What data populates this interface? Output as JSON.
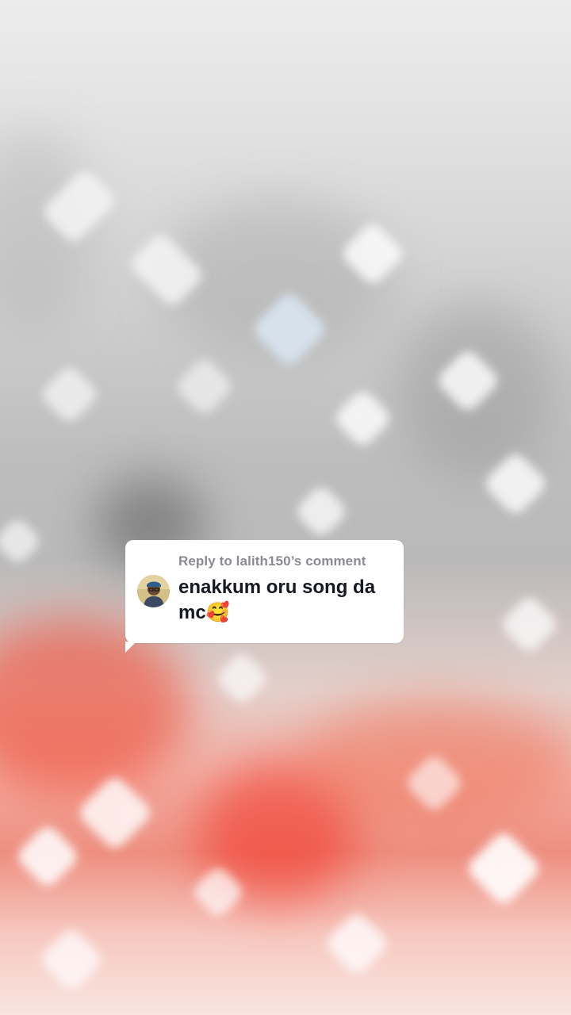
{
  "video": {
    "description_layer": "blurred-video-background"
  },
  "reply_sticker": {
    "reply_label": "Reply to lalith150’s comment",
    "comment_text": "enakkum oru song da mc🥰",
    "avatar_icon": "user-avatar-icon"
  },
  "colors": {
    "card_background": "#ffffff",
    "reply_label": "#8a8b91",
    "comment_text": "#161823",
    "accent_red": "#ee2a1c"
  }
}
